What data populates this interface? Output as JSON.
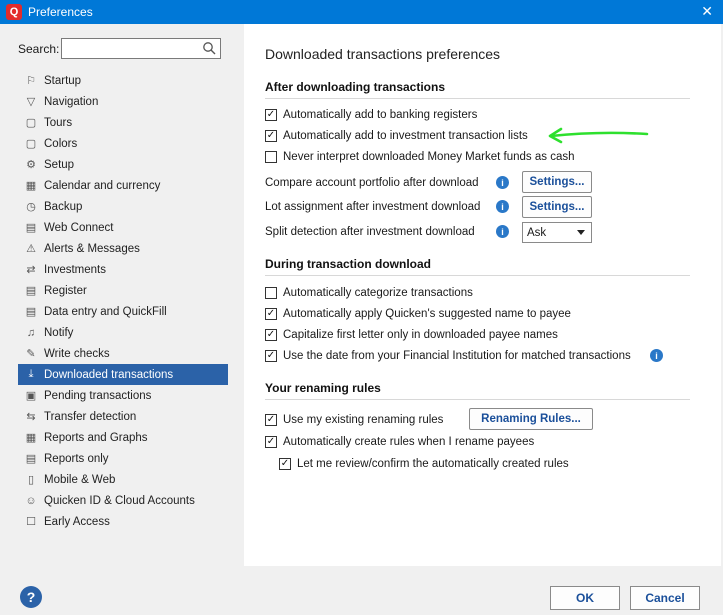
{
  "window": {
    "title": "Preferences",
    "app_icon_letter": "Q"
  },
  "search": {
    "label": "Search:",
    "value": "",
    "placeholder": ""
  },
  "sidebar": {
    "items": [
      {
        "label": "Startup",
        "icon": "startup-icon",
        "glyph": "⚐"
      },
      {
        "label": "Navigation",
        "icon": "navigation-icon",
        "glyph": "▽"
      },
      {
        "label": "Tours",
        "icon": "tours-icon",
        "glyph": "▢"
      },
      {
        "label": "Colors",
        "icon": "colors-icon",
        "glyph": "▢"
      },
      {
        "label": "Setup",
        "icon": "setup-icon",
        "glyph": "⚙"
      },
      {
        "label": "Calendar and currency",
        "icon": "calendar-icon",
        "glyph": "▦"
      },
      {
        "label": "Backup",
        "icon": "backup-icon",
        "glyph": "◷"
      },
      {
        "label": "Web Connect",
        "icon": "web-connect-icon",
        "glyph": "▤"
      },
      {
        "label": "Alerts & Messages",
        "icon": "alerts-icon",
        "glyph": "⚠"
      },
      {
        "label": "Investments",
        "icon": "investments-icon",
        "glyph": "⇄"
      },
      {
        "label": "Register",
        "icon": "register-icon",
        "glyph": "▤"
      },
      {
        "label": "Data entry and QuickFill",
        "icon": "data-entry-icon",
        "glyph": "▤"
      },
      {
        "label": "Notify",
        "icon": "notify-icon",
        "glyph": "♫"
      },
      {
        "label": "Write checks",
        "icon": "write-checks-icon",
        "glyph": "✎"
      },
      {
        "label": "Downloaded transactions",
        "icon": "download-icon",
        "glyph": "⤓"
      },
      {
        "label": "Pending transactions",
        "icon": "pending-icon",
        "glyph": "▣"
      },
      {
        "label": "Transfer detection",
        "icon": "transfer-icon",
        "glyph": "⇆"
      },
      {
        "label": "Reports and Graphs",
        "icon": "reports-graphs-icon",
        "glyph": "▦"
      },
      {
        "label": "Reports only",
        "icon": "reports-icon",
        "glyph": "▤"
      },
      {
        "label": "Mobile & Web",
        "icon": "mobile-icon",
        "glyph": "▯"
      },
      {
        "label": "Quicken ID & Cloud Accounts",
        "icon": "account-icon",
        "glyph": "☺"
      },
      {
        "label": "Early Access",
        "icon": "early-access-icon",
        "glyph": "☐"
      }
    ],
    "selected_index": 14
  },
  "content": {
    "title": "Downloaded transactions preferences",
    "after": {
      "heading": "After downloading transactions",
      "opt1": {
        "label": "Automatically add to banking registers",
        "checked": true
      },
      "opt2": {
        "label": "Automatically add to investment transaction lists",
        "checked": true
      },
      "opt3": {
        "label": "Never interpret downloaded Money Market funds as cash",
        "checked": false
      },
      "compare_label": "Compare account portfolio after download",
      "lot_label": "Lot assignment after investment download",
      "split_label": "Split detection after investment download",
      "settings_label": "Settings...",
      "split_value": "Ask"
    },
    "during": {
      "heading": "During transaction download",
      "opt1": {
        "label": "Automatically categorize transactions",
        "checked": false
      },
      "opt2": {
        "label": "Automatically apply Quicken's suggested name to payee",
        "checked": true
      },
      "opt3": {
        "label": "Capitalize first letter only in downloaded payee names",
        "checked": true
      },
      "opt4": {
        "label": "Use the date from your Financial Institution for matched transactions",
        "checked": true
      }
    },
    "renaming": {
      "heading": "Your renaming rules",
      "opt1": {
        "label": "Use my existing renaming rules",
        "checked": true
      },
      "button_label": "Renaming Rules...",
      "opt2": {
        "label": "Automatically create rules when I rename payees",
        "checked": true
      },
      "opt3": {
        "label": "Let me review/confirm the automatically created rules",
        "checked": true
      }
    }
  },
  "footer": {
    "help": "?",
    "ok": "OK",
    "cancel": "Cancel"
  },
  "colors": {
    "accent": "#0078d7",
    "selected": "#2b62a8",
    "annotation": "#2ee02e"
  }
}
